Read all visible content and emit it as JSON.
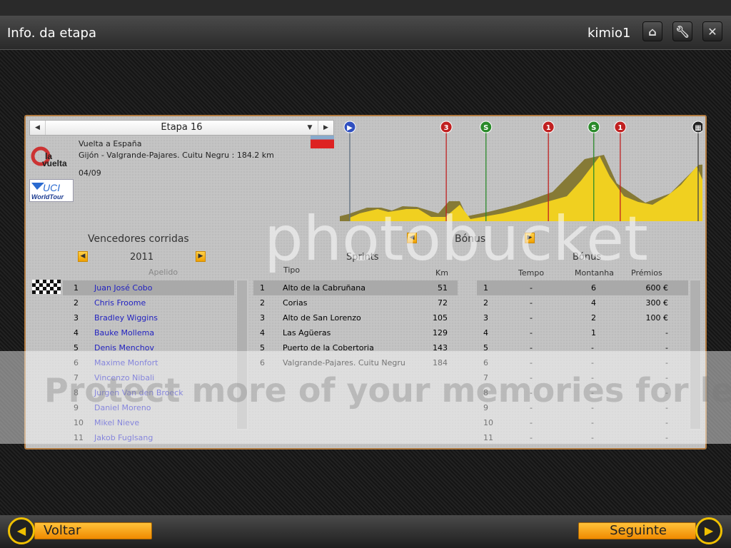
{
  "header": {
    "title": "Info. da etapa",
    "user": "kimio1",
    "buttons": [
      {
        "icon": "home-icon"
      },
      {
        "icon": "wrench-icon"
      },
      {
        "icon": "close-icon"
      }
    ]
  },
  "stage": {
    "selector": "Etapa 16",
    "race": "Vuelta a España",
    "route": "Gijón - Valgrande-Pajares. Cuitu Negru : 184.2 km",
    "date": "04/09",
    "distance_km": 184.2,
    "logo_text": "la vuelta",
    "tour_text": "UCI WorldTour"
  },
  "profile": {
    "markers": [
      {
        "type": "start",
        "label": "",
        "km": 0,
        "color": "#3050c0"
      },
      {
        "type": "climb",
        "label": "3",
        "km": 51,
        "color": "#c02020"
      },
      {
        "type": "sprint",
        "label": "S",
        "km": 72,
        "color": "#2a8a2a"
      },
      {
        "type": "climb",
        "label": "1",
        "km": 105,
        "color": "#c02020"
      },
      {
        "type": "sprint",
        "label": "S",
        "km": 129,
        "color": "#2a8a2a"
      },
      {
        "type": "climb",
        "label": "1",
        "km": 143,
        "color": "#c02020"
      },
      {
        "type": "finish",
        "label": "",
        "km": 184.2,
        "color": "#222222"
      }
    ]
  },
  "winners": {
    "title": "Vencedores corridas",
    "year": "2011",
    "col": "Apelido",
    "rows": [
      {
        "rank": "1",
        "name": "Juan José Cobo"
      },
      {
        "rank": "2",
        "name": "Chris Froome"
      },
      {
        "rank": "3",
        "name": "Bradley Wiggins"
      },
      {
        "rank": "4",
        "name": "Bauke Mollema"
      },
      {
        "rank": "5",
        "name": "Denis Menchov"
      },
      {
        "rank": "6",
        "name": "Maxime Monfort"
      },
      {
        "rank": "7",
        "name": "Vincenzo Nibali"
      },
      {
        "rank": "8",
        "name": "Jurgen Van den Broeck"
      },
      {
        "rank": "9",
        "name": "Daniel Moreno"
      },
      {
        "rank": "10",
        "name": "Mikel Nieve"
      },
      {
        "rank": "11",
        "name": "Jakob Fuglsang"
      }
    ]
  },
  "bonus_section": {
    "title": "Bónus"
  },
  "sprints": {
    "title": "Sprints",
    "col_tipo": "Tipo",
    "col_km": "Km",
    "rows": [
      {
        "rank": "1",
        "name": "Alto de la Cabruñana",
        "km": "51"
      },
      {
        "rank": "2",
        "name": "Corias",
        "km": "72"
      },
      {
        "rank": "3",
        "name": "Alto de San Lorenzo",
        "km": "105"
      },
      {
        "rank": "4",
        "name": "Las Agüeras",
        "km": "129"
      },
      {
        "rank": "5",
        "name": "Puerto de la Cobertoria",
        "km": "143"
      },
      {
        "rank": "6",
        "name": "Valgrande-Pajares. Cuitu Negru",
        "km": "184"
      }
    ]
  },
  "bonus": {
    "title": "Bónus",
    "col_tempo": "Tempo",
    "col_montanha": "Montanha",
    "col_premios": "Prémios",
    "rows": [
      {
        "rank": "1",
        "tempo": "-",
        "montanha": "6",
        "premios": "600 €"
      },
      {
        "rank": "2",
        "tempo": "-",
        "montanha": "4",
        "premios": "300 €"
      },
      {
        "rank": "3",
        "tempo": "-",
        "montanha": "2",
        "premios": "100 €"
      },
      {
        "rank": "4",
        "tempo": "-",
        "montanha": "1",
        "premios": "-"
      },
      {
        "rank": "5",
        "tempo": "-",
        "montanha": "-",
        "premios": "-"
      },
      {
        "rank": "6",
        "tempo": "-",
        "montanha": "-",
        "premios": "-"
      },
      {
        "rank": "7",
        "tempo": "-",
        "montanha": "-",
        "premios": "-"
      },
      {
        "rank": "8",
        "tempo": "-",
        "montanha": "-",
        "premios": "-"
      },
      {
        "rank": "9",
        "tempo": "-",
        "montanha": "-",
        "premios": "-"
      },
      {
        "rank": "10",
        "tempo": "-",
        "montanha": "-",
        "premios": "-"
      },
      {
        "rank": "11",
        "tempo": "-",
        "montanha": "-",
        "premios": "-"
      }
    ]
  },
  "footer": {
    "back": "Voltar",
    "next": "Seguinte"
  },
  "watermark": {
    "brand": "photobucket",
    "slogan": "Protect more of your memories for less!"
  }
}
